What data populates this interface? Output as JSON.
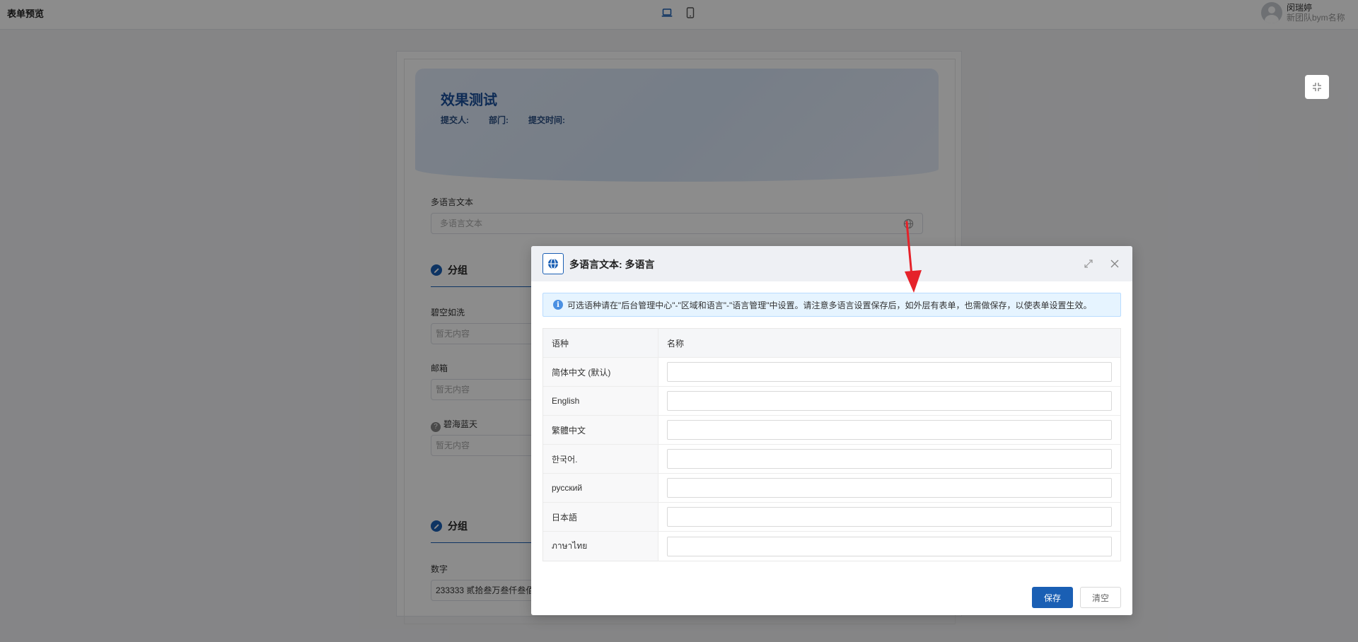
{
  "header": {
    "title": "表单预览",
    "user_name": "闵瑞婷",
    "team_name": "新团队bym名称"
  },
  "form": {
    "banner_title": "效果测试",
    "meta": {
      "submitter": "提交人:",
      "department": "部门:",
      "submit_time": "提交时间:"
    },
    "multilang_label": "多语言文本",
    "multilang_placeholder": "多语言文本",
    "group1_title": "分组",
    "field1_label": "碧空如洗",
    "field1_value": "暂无内容",
    "field2_label": "邮箱",
    "field2_value": "暂无内容",
    "field3_label": "碧海蓝天",
    "field3_value": "暂无内容",
    "group2_title": "分组",
    "number_label": "数字",
    "number_value": "233333 贰拾叁万叁仟叁佰"
  },
  "dialog": {
    "title": "多语言文本: 多语言",
    "notice": "可选语种请在\"后台管理中心\"-\"区域和语言\"-\"语言管理\"中设置。请注意多语言设置保存后，如外层有表单，也需做保存，以使表单设置生效。",
    "col_lang": "语种",
    "col_name": "名称",
    "rows": [
      {
        "lang": "简体中文 (默认)",
        "value": ""
      },
      {
        "lang": "English",
        "value": ""
      },
      {
        "lang": "繁體中文",
        "value": ""
      },
      {
        "lang": "한국어.",
        "value": ""
      },
      {
        "lang": "русский",
        "value": ""
      },
      {
        "lang": "日本語",
        "value": ""
      },
      {
        "lang": "ภาษาไทย",
        "value": ""
      }
    ],
    "save_label": "保存",
    "clear_label": "清空"
  },
  "colors": {
    "primary": "#1a5fb4",
    "annotation": "#e5222a"
  }
}
